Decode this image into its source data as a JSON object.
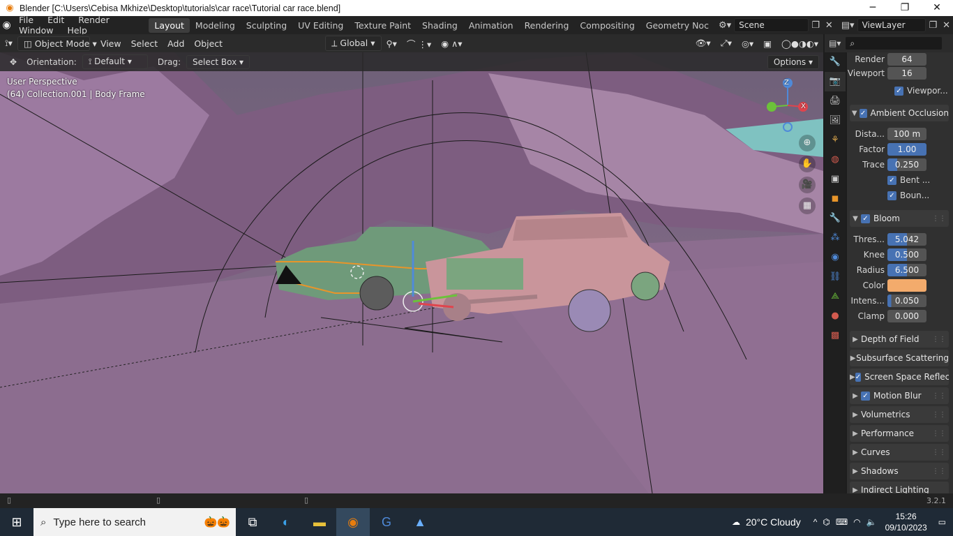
{
  "window": {
    "title": "Blender [C:\\Users\\Cebisa Mkhize\\Desktop\\tutorials\\car race\\Tutorial car race.blend]",
    "minimize": "─",
    "maximize": "❐",
    "close": "✕"
  },
  "menu": [
    "File",
    "Edit",
    "Render",
    "Window",
    "Help"
  ],
  "workspaces": [
    "Layout",
    "Modeling",
    "Sculpting",
    "UV Editing",
    "Texture Paint",
    "Shading",
    "Animation",
    "Rendering",
    "Compositing",
    "Geometry Noc"
  ],
  "active_workspace": "Layout",
  "scene": "Scene",
  "view_layer": "ViewLayer",
  "viewport_header": {
    "mode": "Object Mode",
    "items": [
      "View",
      "Select",
      "Add",
      "Object"
    ],
    "transform": "Global"
  },
  "tool_header": {
    "orientation_label": "Orientation:",
    "orientation": "Default",
    "drag_label": "Drag:",
    "drag": "Select Box",
    "options": "Options"
  },
  "viewport": {
    "perspective": "User Perspective",
    "collection": "(64) Collection.001 | Body Frame",
    "axis_z": "Z",
    "axis_x": "X"
  },
  "properties": {
    "render_label": "Render",
    "render_value": "64",
    "viewport_label": "Viewport",
    "viewport_value": "16",
    "viewport_denoise": "Viewpor...",
    "ao": {
      "title": "Ambient Occlusion",
      "distance_label": "Dista...",
      "distance": "100 m",
      "factor_label": "Factor",
      "factor": "1.00",
      "trace_label": "Trace",
      "trace": "0.250",
      "bent": "Bent ...",
      "bounces": "Boun..."
    },
    "bloom": {
      "title": "Bloom",
      "threshold_label": "Thres...",
      "threshold": "5.042",
      "knee_label": "Knee",
      "knee": "0.500",
      "radius_label": "Radius",
      "radius": "6.500",
      "color_label": "Color",
      "intensity_label": "Intens...",
      "intensity": "0.050",
      "clamp_label": "Clamp",
      "clamp": "0.000"
    },
    "panels": [
      "Depth of Field",
      "Subsurface Scattering",
      "Screen Space Reflec",
      "Motion Blur",
      "Volumetrics",
      "Performance",
      "Curves",
      "Shadows",
      "Indirect Lighting"
    ]
  },
  "status": {
    "version": "3.2.1"
  },
  "taskbar": {
    "search_placeholder": "Type here to search",
    "weather": "20°C  Cloudy",
    "time": "15:26",
    "date": "09/10/2023"
  },
  "colors": {
    "accent": "#4772b3",
    "bloom_color": "#f3ab6c",
    "viewport_bg": "#8a6b8d"
  }
}
